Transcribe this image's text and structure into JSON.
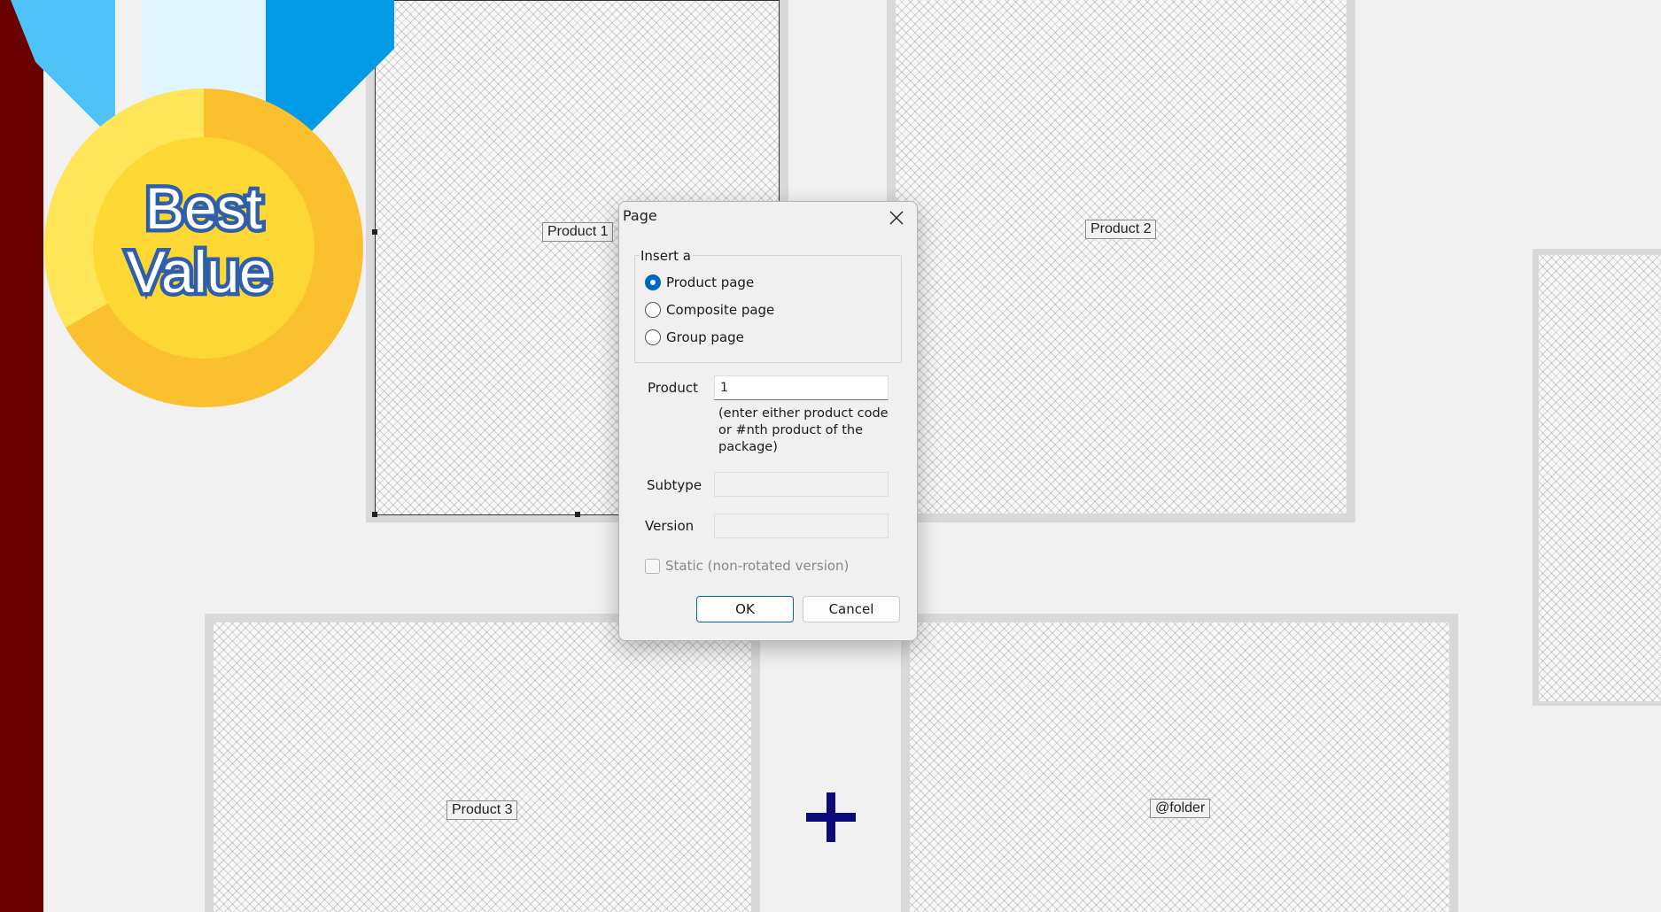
{
  "canvas": {
    "pages": [
      {
        "label": "Product 1"
      },
      {
        "label": "Product 2"
      },
      {
        "label": "Product 3"
      },
      {
        "label": "@folder"
      },
      {
        "label": ""
      }
    ]
  },
  "badge": {
    "line1": "Best",
    "line2": "Value"
  },
  "dialog": {
    "title": "Page",
    "group_label": "Insert a",
    "options": [
      {
        "label": "Product page",
        "checked": true
      },
      {
        "label": "Composite page",
        "checked": false
      },
      {
        "label": "Group page",
        "checked": false
      }
    ],
    "product_label": "Product",
    "product_value": "1",
    "product_hint": "(enter either product code or #nth product of the package)",
    "subtype_label": "Subtype",
    "subtype_value": "",
    "version_label": "Version",
    "version_value": "",
    "static_label": "Static (non-rotated version)",
    "static_checked": false,
    "ok_label": "OK",
    "cancel_label": "Cancel"
  },
  "colors": {
    "sidebar": "#6b0000",
    "accent": "#0067c0",
    "plus": "#0a0a7a",
    "medal_gold": "#fbc02d",
    "ribbon_blue": "#039be5"
  }
}
